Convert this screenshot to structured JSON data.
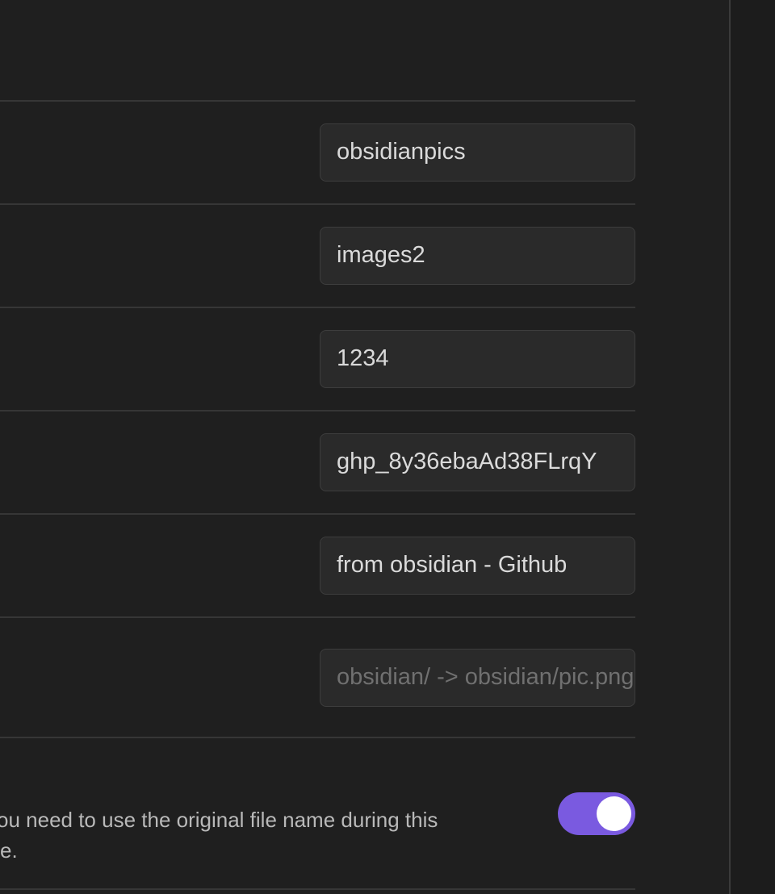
{
  "settings": {
    "fields": [
      {
        "value": "obsidianpics",
        "placeholder": ""
      },
      {
        "value": "images2",
        "placeholder": ""
      },
      {
        "value": "1234",
        "placeholder": ""
      },
      {
        "value": "ghp_8y36ebaAd38FLrqY",
        "placeholder": ""
      },
      {
        "value": "from obsidian - Github",
        "placeholder": ""
      },
      {
        "value": "",
        "placeholder": "obsidian/ -> obsidian/pic.png"
      }
    ],
    "original_filename_setting": {
      "description_line1": "ou need to use the original file name during this",
      "description_line2": "e.",
      "toggle_on": true
    }
  },
  "colors": {
    "background": "#1f1f1f",
    "input_background": "#2a2a2a",
    "accent": "#7a5ae0"
  }
}
